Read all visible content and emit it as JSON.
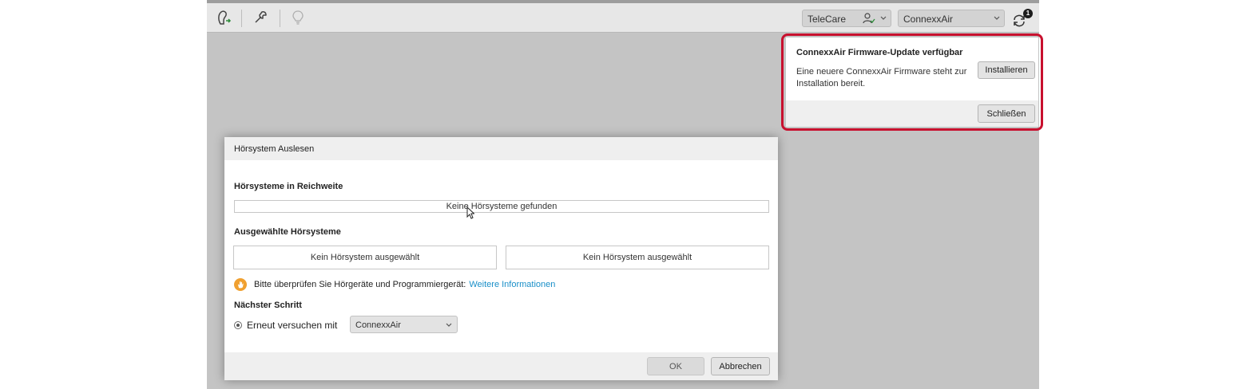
{
  "toolbar": {
    "telecare_label": "TeleCare",
    "device_label": "ConnexxAir",
    "sync_badge": "1",
    "icons": [
      "hearing-aid-icon",
      "wrench-icon",
      "lightbulb-icon",
      "user-check-icon",
      "sync-icon"
    ]
  },
  "notification": {
    "title": "ConnexxAir Firmware-Update verfügbar",
    "body": "Eine neuere ConnexxAir Firmware steht zur Installation bereit.",
    "install_label": "Installieren",
    "close_label": "Schließen",
    "highlight_color": "#c8102e"
  },
  "dialog": {
    "title": "Hörsystem Auslesen",
    "in_range_label": "Hörsysteme in Reichweite",
    "none_found": "Keine Hörsysteme gefunden",
    "selected_label": "Ausgewählte Hörsysteme",
    "slot_left": "Kein Hörsystem ausgewählt",
    "slot_right": "Kein Hörsystem ausgewählt",
    "warning_text": "Bitte überprüfen Sie Hörgeräte und Programmiergerät:",
    "warning_link": "Weitere Informationen",
    "next_step_label": "Nächster Schritt",
    "retry_label": "Erneut versuchen mit",
    "retry_device": "ConnexxAir",
    "ok_label": "OK",
    "cancel_label": "Abbrechen"
  },
  "colors": {
    "link": "#1a8fc8",
    "warning": "#f0a030"
  }
}
